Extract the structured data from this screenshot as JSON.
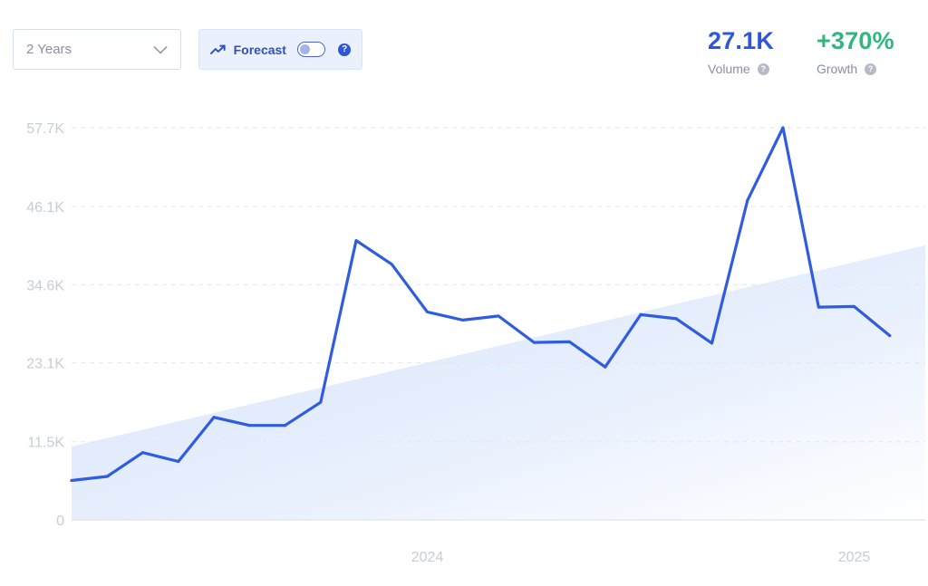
{
  "controls": {
    "range_value": "2 Years",
    "forecast_label": "Forecast",
    "forecast_enabled": false,
    "help_symbol": "?"
  },
  "stats": {
    "volume": {
      "value": "27.1K",
      "label": "Volume",
      "color": "#2d56d8"
    },
    "growth": {
      "value": "+370%",
      "label": "Growth",
      "color": "#2db87d"
    }
  },
  "icons": {
    "range_select": "chevron-down-icon",
    "forecast": "trending-up-icon",
    "help": "question-circle-icon"
  },
  "colors": {
    "line": "#2f5ce0",
    "trend_fill": "#dbe7fb",
    "grid": "#e3e6ee"
  },
  "chart_data": {
    "type": "line",
    "title": "",
    "xlabel": "",
    "ylabel": "",
    "x_tick_labels": [
      "2024",
      "2025"
    ],
    "x_tick_months": [
      "2024-01",
      "2025-01"
    ],
    "y_tick_labels": [
      "0",
      "11.5K",
      "23.1K",
      "34.6K",
      "46.1K",
      "57.7K"
    ],
    "y_tick_values": [
      0,
      11500,
      23100,
      34600,
      46100,
      57700
    ],
    "ylim": [
      0,
      57700
    ],
    "grid": true,
    "legend": "none",
    "x": [
      "2023-03",
      "2023-04",
      "2023-05",
      "2023-06",
      "2023-07",
      "2023-08",
      "2023-09",
      "2023-10",
      "2023-11",
      "2023-12",
      "2024-01",
      "2024-02",
      "2024-03",
      "2024-04",
      "2024-05",
      "2024-06",
      "2024-07",
      "2024-08",
      "2024-09",
      "2024-10",
      "2024-11",
      "2024-12",
      "2025-01",
      "2025-02",
      "2025-03"
    ],
    "series": [
      {
        "values": [
          5800,
          6400,
          9900,
          8600,
          15100,
          13900,
          13900,
          17300,
          41100,
          37600,
          30600,
          29400,
          30000,
          26100,
          26200,
          22500,
          30200,
          29600,
          26000,
          47000,
          57700,
          31300,
          31400,
          27100
        ]
      }
    ],
    "trend": {
      "start": 10800,
      "end": 40400
    }
  }
}
